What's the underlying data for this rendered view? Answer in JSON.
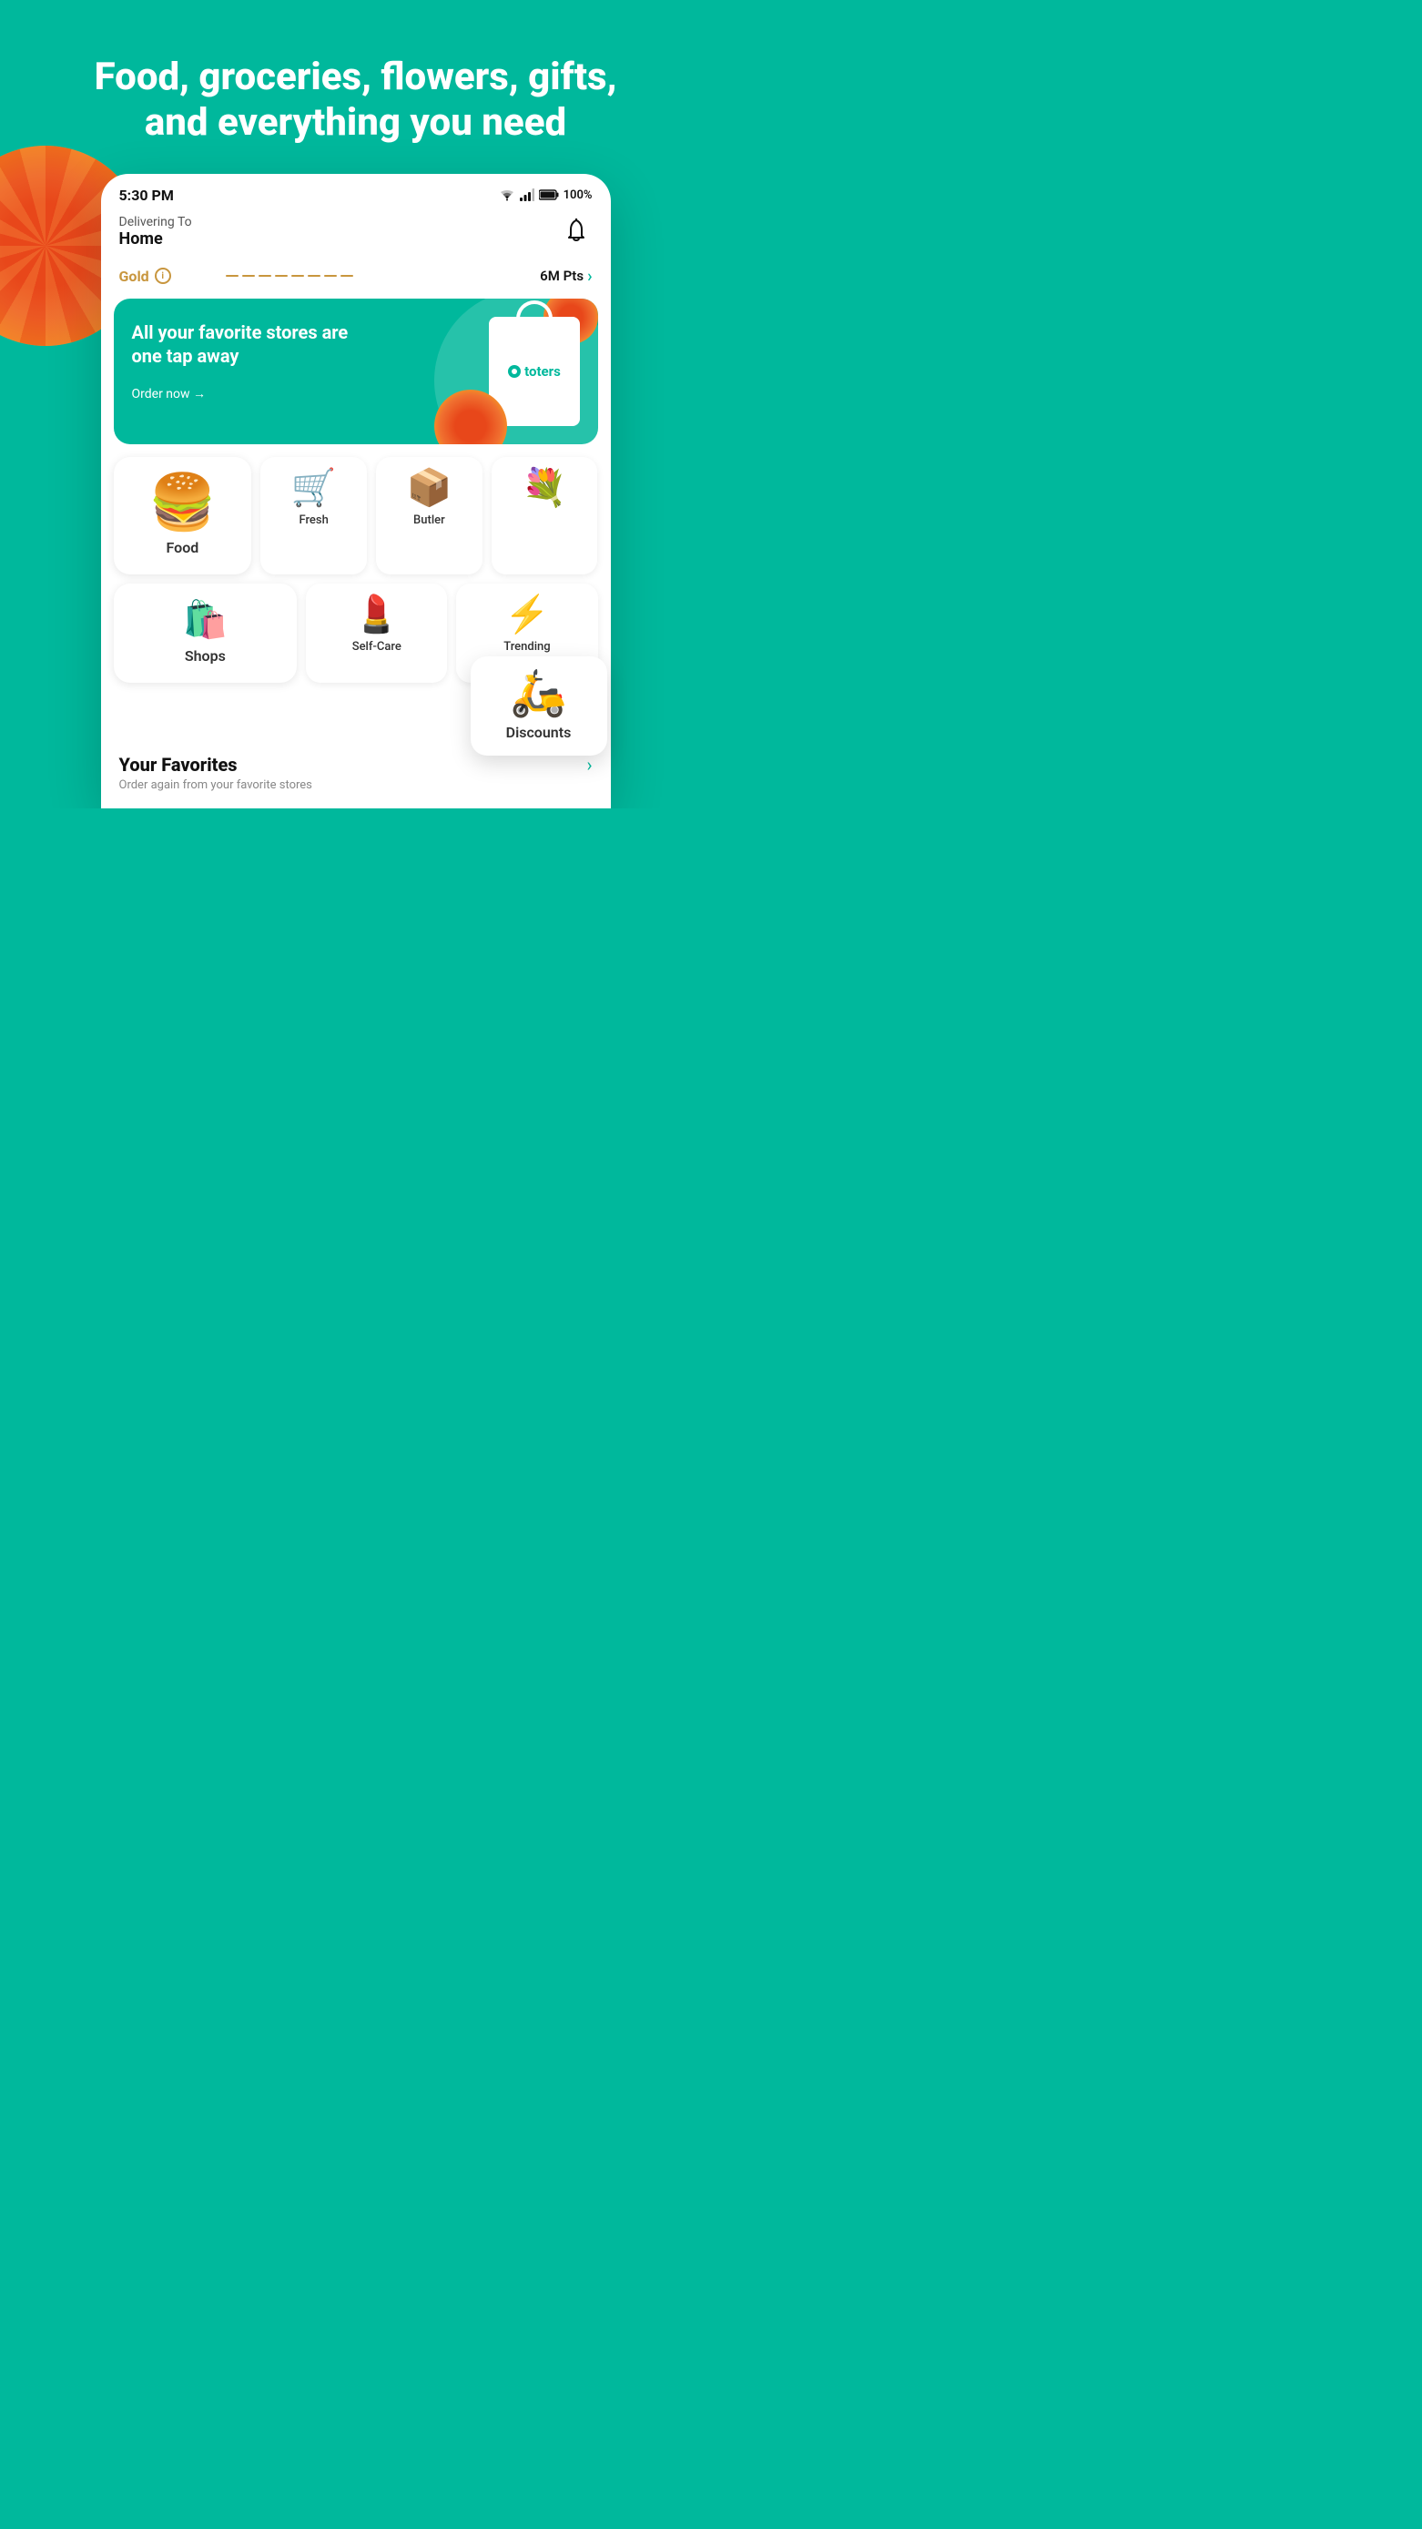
{
  "background_color": "#00B89C",
  "hero": {
    "title": "Food, groceries, flowers, gifts, and everything you need"
  },
  "status_bar": {
    "time": "5:30 PM",
    "battery": "100%"
  },
  "header": {
    "delivering_to": "Delivering To",
    "location": "Home"
  },
  "gold": {
    "label": "Gold",
    "info": "i",
    "points_label": "6M Pts",
    "arrow": "›"
  },
  "banner": {
    "text": "All your favorite stores are one tap away",
    "cta": "Order now →",
    "bag_brand": "toters"
  },
  "categories": {
    "row1": [
      {
        "id": "food",
        "label": "Food",
        "emoji": "🍔",
        "large": true
      },
      {
        "id": "fresh",
        "label": "Fresh",
        "emoji": "🛒"
      },
      {
        "id": "butler",
        "label": "Butler",
        "emoji": "📦"
      },
      {
        "id": "flowers",
        "label": "",
        "emoji": "💐"
      }
    ],
    "row2": [
      {
        "id": "shops",
        "label": "Shops",
        "emoji": "🛍️"
      },
      {
        "id": "self-care",
        "label": "Self-Care",
        "emoji": "💄"
      },
      {
        "id": "trending",
        "label": "Trending",
        "emoji": "⚡"
      }
    ],
    "discounts": {
      "id": "discounts",
      "label": "Discounts",
      "emoji": "🛵"
    }
  },
  "favorites": {
    "title": "Your Favorites",
    "subtitle": "Order again from your favorite stores",
    "arrow": "›"
  }
}
